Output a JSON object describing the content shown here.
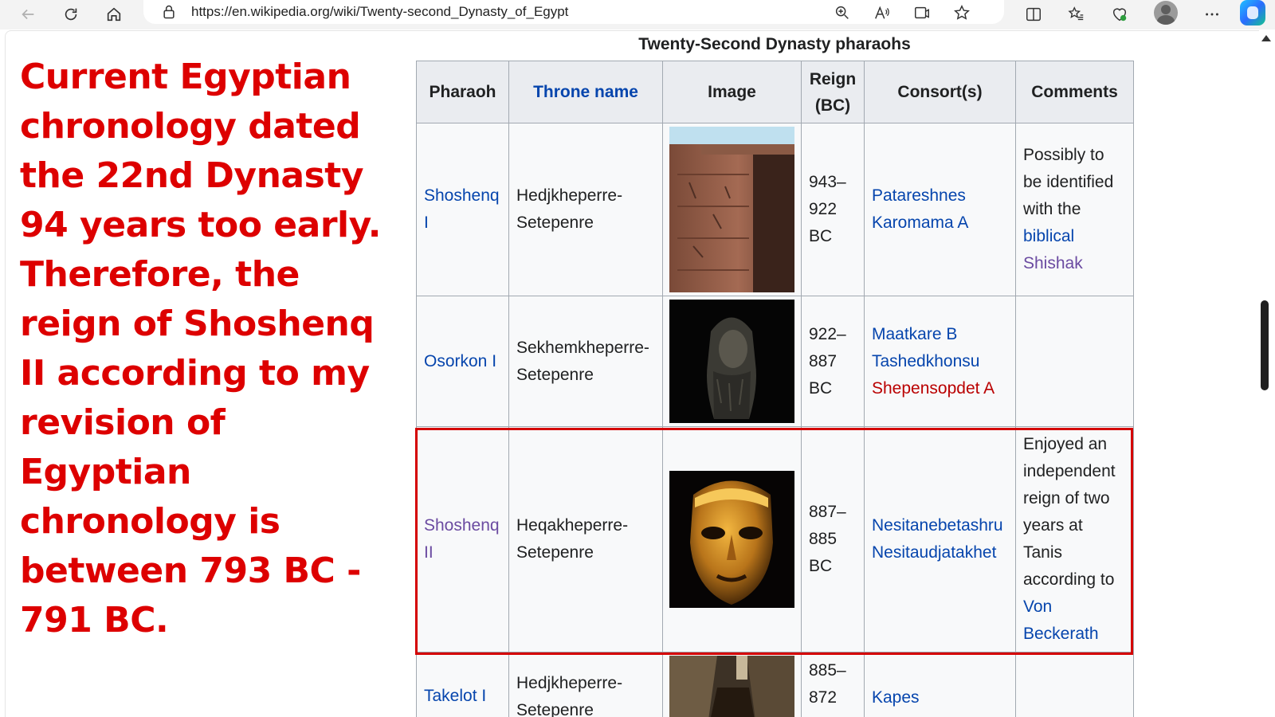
{
  "browser": {
    "url": "https://en.wikipedia.org/wiki/Twenty-second_Dynasty_of_Egypt"
  },
  "annotation": {
    "text": "Current Egyptian chronology dated the 22nd Dynasty 94 years too early. Therefore,  the reign of Shoshenq II according to my revision of Egyptian chronology is between 793 BC - 791 BC."
  },
  "table": {
    "caption": "Twenty-Second Dynasty pharaohs",
    "headers": {
      "pharaoh": "Pharaoh",
      "throne": "Throne name",
      "image": "Image",
      "reign_top": "Reign",
      "reign_bottom": "(BC)",
      "consorts": "Consort(s)",
      "comments": "Comments"
    },
    "rows": [
      {
        "pharaoh": [
          "Shoshenq",
          "I"
        ],
        "throne": [
          "Hedjkheperre-",
          "Setepenre"
        ],
        "image": "temple-relief-wall-photo",
        "reign": [
          "943–",
          "922",
          "BC"
        ],
        "consorts": [
          "Patareshnes",
          "Karomama A"
        ],
        "comments": [
          "Possibly to",
          "be identified",
          "with the",
          "biblical",
          "Shishak"
        ]
      },
      {
        "pharaoh": [
          "Osorkon I"
        ],
        "throne": [
          "Sekhemkheperre-",
          "Setepenre"
        ],
        "image": "statue-bust-photo",
        "reign": [
          "922–",
          "887",
          "BC"
        ],
        "consorts": [
          "Maatkare B",
          "Tashedkhonsu",
          "Shepensopdet A"
        ],
        "comments": []
      },
      {
        "pharaoh": [
          "Shoshenq",
          "II"
        ],
        "throne": [
          "Heqakheperre-",
          "Setepenre"
        ],
        "image": "gold-funerary-mask-photo",
        "reign": [
          "887–",
          "885",
          "BC"
        ],
        "consorts": [
          "Nesitanebetashru",
          "Nesitaudjatakhet"
        ],
        "comments": [
          "Enjoyed an",
          "independent",
          "reign of two",
          "years at",
          "Tanis",
          "according to",
          "Von",
          "Beckerath"
        ]
      },
      {
        "pharaoh": [
          "Takelot I"
        ],
        "throne": [
          "Hedjkheperre-",
          "Setepenre"
        ],
        "image": "tomb-interior-photo",
        "reign": [
          "885–",
          "872"
        ],
        "consorts": [
          "Kapes"
        ],
        "comments": []
      }
    ]
  },
  "colors": {
    "annotation": "#dd0000",
    "link": "#0645ad",
    "visited_link": "#6b4ba1",
    "red_link": "#ba0000",
    "highlight_box": "#d40000"
  }
}
